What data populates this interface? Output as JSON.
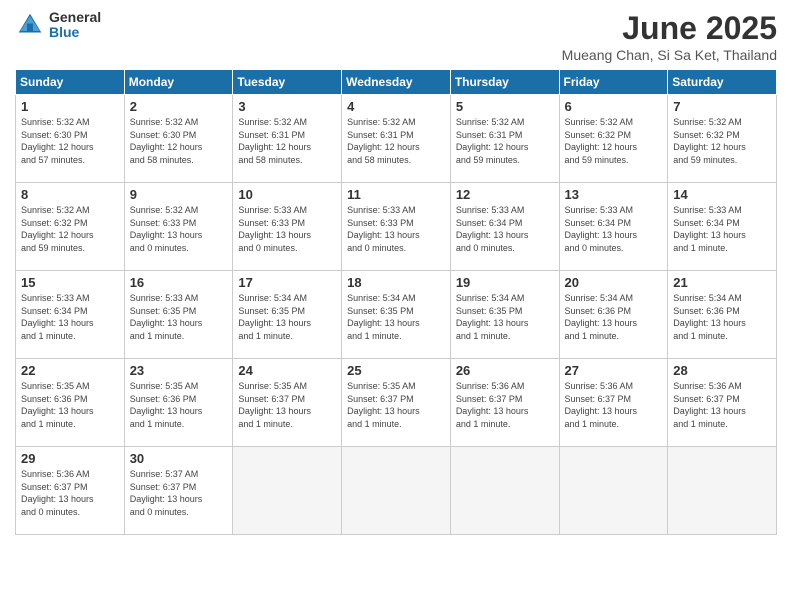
{
  "logo": {
    "general": "General",
    "blue": "Blue"
  },
  "title": "June 2025",
  "subtitle": "Mueang Chan, Si Sa Ket, Thailand",
  "weekdays": [
    "Sunday",
    "Monday",
    "Tuesday",
    "Wednesday",
    "Thursday",
    "Friday",
    "Saturday"
  ],
  "weeks": [
    [
      {
        "day": "1",
        "info": "Sunrise: 5:32 AM\nSunset: 6:30 PM\nDaylight: 12 hours\nand 57 minutes."
      },
      {
        "day": "2",
        "info": "Sunrise: 5:32 AM\nSunset: 6:30 PM\nDaylight: 12 hours\nand 58 minutes."
      },
      {
        "day": "3",
        "info": "Sunrise: 5:32 AM\nSunset: 6:31 PM\nDaylight: 12 hours\nand 58 minutes."
      },
      {
        "day": "4",
        "info": "Sunrise: 5:32 AM\nSunset: 6:31 PM\nDaylight: 12 hours\nand 58 minutes."
      },
      {
        "day": "5",
        "info": "Sunrise: 5:32 AM\nSunset: 6:31 PM\nDaylight: 12 hours\nand 59 minutes."
      },
      {
        "day": "6",
        "info": "Sunrise: 5:32 AM\nSunset: 6:32 PM\nDaylight: 12 hours\nand 59 minutes."
      },
      {
        "day": "7",
        "info": "Sunrise: 5:32 AM\nSunset: 6:32 PM\nDaylight: 12 hours\nand 59 minutes."
      }
    ],
    [
      {
        "day": "8",
        "info": "Sunrise: 5:32 AM\nSunset: 6:32 PM\nDaylight: 12 hours\nand 59 minutes."
      },
      {
        "day": "9",
        "info": "Sunrise: 5:32 AM\nSunset: 6:33 PM\nDaylight: 13 hours\nand 0 minutes."
      },
      {
        "day": "10",
        "info": "Sunrise: 5:33 AM\nSunset: 6:33 PM\nDaylight: 13 hours\nand 0 minutes."
      },
      {
        "day": "11",
        "info": "Sunrise: 5:33 AM\nSunset: 6:33 PM\nDaylight: 13 hours\nand 0 minutes."
      },
      {
        "day": "12",
        "info": "Sunrise: 5:33 AM\nSunset: 6:34 PM\nDaylight: 13 hours\nand 0 minutes."
      },
      {
        "day": "13",
        "info": "Sunrise: 5:33 AM\nSunset: 6:34 PM\nDaylight: 13 hours\nand 0 minutes."
      },
      {
        "day": "14",
        "info": "Sunrise: 5:33 AM\nSunset: 6:34 PM\nDaylight: 13 hours\nand 1 minute."
      }
    ],
    [
      {
        "day": "15",
        "info": "Sunrise: 5:33 AM\nSunset: 6:34 PM\nDaylight: 13 hours\nand 1 minute."
      },
      {
        "day": "16",
        "info": "Sunrise: 5:33 AM\nSunset: 6:35 PM\nDaylight: 13 hours\nand 1 minute."
      },
      {
        "day": "17",
        "info": "Sunrise: 5:34 AM\nSunset: 6:35 PM\nDaylight: 13 hours\nand 1 minute."
      },
      {
        "day": "18",
        "info": "Sunrise: 5:34 AM\nSunset: 6:35 PM\nDaylight: 13 hours\nand 1 minute."
      },
      {
        "day": "19",
        "info": "Sunrise: 5:34 AM\nSunset: 6:35 PM\nDaylight: 13 hours\nand 1 minute."
      },
      {
        "day": "20",
        "info": "Sunrise: 5:34 AM\nSunset: 6:36 PM\nDaylight: 13 hours\nand 1 minute."
      },
      {
        "day": "21",
        "info": "Sunrise: 5:34 AM\nSunset: 6:36 PM\nDaylight: 13 hours\nand 1 minute."
      }
    ],
    [
      {
        "day": "22",
        "info": "Sunrise: 5:35 AM\nSunset: 6:36 PM\nDaylight: 13 hours\nand 1 minute."
      },
      {
        "day": "23",
        "info": "Sunrise: 5:35 AM\nSunset: 6:36 PM\nDaylight: 13 hours\nand 1 minute."
      },
      {
        "day": "24",
        "info": "Sunrise: 5:35 AM\nSunset: 6:37 PM\nDaylight: 13 hours\nand 1 minute."
      },
      {
        "day": "25",
        "info": "Sunrise: 5:35 AM\nSunset: 6:37 PM\nDaylight: 13 hours\nand 1 minute."
      },
      {
        "day": "26",
        "info": "Sunrise: 5:36 AM\nSunset: 6:37 PM\nDaylight: 13 hours\nand 1 minute."
      },
      {
        "day": "27",
        "info": "Sunrise: 5:36 AM\nSunset: 6:37 PM\nDaylight: 13 hours\nand 1 minute."
      },
      {
        "day": "28",
        "info": "Sunrise: 5:36 AM\nSunset: 6:37 PM\nDaylight: 13 hours\nand 1 minute."
      }
    ],
    [
      {
        "day": "29",
        "info": "Sunrise: 5:36 AM\nSunset: 6:37 PM\nDaylight: 13 hours\nand 0 minutes."
      },
      {
        "day": "30",
        "info": "Sunrise: 5:37 AM\nSunset: 6:37 PM\nDaylight: 13 hours\nand 0 minutes."
      },
      {
        "day": "",
        "info": ""
      },
      {
        "day": "",
        "info": ""
      },
      {
        "day": "",
        "info": ""
      },
      {
        "day": "",
        "info": ""
      },
      {
        "day": "",
        "info": ""
      }
    ]
  ]
}
